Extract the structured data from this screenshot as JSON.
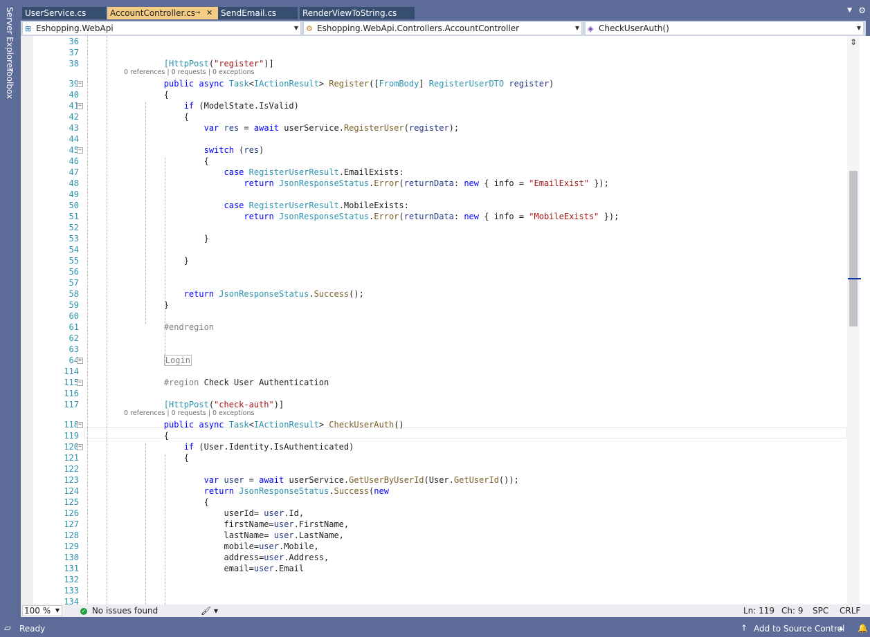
{
  "sidebar": {
    "server_explorer": "Server Explorer",
    "toolbox": "Toolbox"
  },
  "tabs": [
    {
      "label": "UserService.cs",
      "active": false
    },
    {
      "label": "AccountController.cs",
      "active": true
    },
    {
      "label": "SendEmail.cs",
      "active": false
    },
    {
      "label": "RenderViewToString.cs",
      "active": false
    }
  ],
  "tab_pin_glyph": "⊸",
  "tab_close_glyph": "✕",
  "navbar": {
    "project": "Eshopping.WebApi",
    "type": "Eshopping.WebApi.Controllers.AccountController",
    "member": "CheckUserAuth()"
  },
  "codelens": "0 references | 0 requests | 0 exceptions",
  "lines": [
    {
      "n": "36",
      "code": ""
    },
    {
      "n": "37",
      "code": ""
    },
    {
      "n": "38",
      "code": "        <span class=\"t\">[HttpPost</span>(<span class=\"s\">\"register\"</span>)]"
    },
    {
      "n": "39",
      "code": "        <span class=\"k\">public</span> <span class=\"k\">async</span> <span class=\"t\">Task</span>&lt;<span class=\"t\">IActionResult</span>&gt; <span class=\"m\">Register</span>([<span class=\"t\">FromBody</span>] <span class=\"t\">RegisterUserDTO</span> <span class=\"p\">register</span>)"
    },
    {
      "n": "40",
      "code": "        {"
    },
    {
      "n": "41",
      "code": "            <span class=\"k\">if</span> (ModelState.IsValid)"
    },
    {
      "n": "42",
      "code": "            {"
    },
    {
      "n": "43",
      "code": "                <span class=\"k\">var</span> <span class=\"p\">res</span> = <span class=\"k\">await</span> userService.<span class=\"m\">RegisterUser</span>(<span class=\"p\">register</span>);"
    },
    {
      "n": "44",
      "code": ""
    },
    {
      "n": "45",
      "code": "                <span class=\"k\">switch</span> (<span class=\"p\">res</span>)"
    },
    {
      "n": "46",
      "code": "                {"
    },
    {
      "n": "47",
      "code": "                    <span class=\"k\">case</span> <span class=\"t\">RegisterUserResult</span>.EmailExists:"
    },
    {
      "n": "48",
      "code": "                        <span class=\"k\">return</span> <span class=\"t\">JsonResponseStatus</span>.<span class=\"m\">Error</span>(<span class=\"p\">returnData</span>: <span class=\"k\">new</span> { info = <span class=\"s\">\"EmailExist\"</span> });"
    },
    {
      "n": "49",
      "code": ""
    },
    {
      "n": "50",
      "code": "                    <span class=\"k\">case</span> <span class=\"t\">RegisterUserResult</span>.MobileExists:"
    },
    {
      "n": "51",
      "code": "                        <span class=\"k\">return</span> <span class=\"t\">JsonResponseStatus</span>.<span class=\"m\">Error</span>(<span class=\"p\">returnData</span>: <span class=\"k\">new</span> { info = <span class=\"s\">\"MobileExists\"</span> });"
    },
    {
      "n": "52",
      "code": ""
    },
    {
      "n": "53",
      "code": "                }"
    },
    {
      "n": "54",
      "code": ""
    },
    {
      "n": "55",
      "code": "            }"
    },
    {
      "n": "56",
      "code": ""
    },
    {
      "n": "57",
      "code": ""
    },
    {
      "n": "58",
      "code": "            <span class=\"k\">return</span> <span class=\"t\">JsonResponseStatus</span>.<span class=\"m\">Success</span>();"
    },
    {
      "n": "59",
      "code": "        }"
    },
    {
      "n": "60",
      "code": ""
    },
    {
      "n": "61",
      "code": "        <span class=\"g\">#endregion</span>"
    },
    {
      "n": "62",
      "code": ""
    },
    {
      "n": "63",
      "code": ""
    },
    {
      "n": "64",
      "code": "        <span class=\"collapsed\">Login</span>"
    },
    {
      "n": "114",
      "code": ""
    },
    {
      "n": "115",
      "code": "        <span class=\"g\">#region</span> Check User Authentication"
    },
    {
      "n": "116",
      "code": ""
    },
    {
      "n": "117",
      "code": "        <span class=\"t\">[HttpPost</span>(<span class=\"s\">\"check-auth\"</span>)]"
    },
    {
      "n": "118",
      "code": "        <span class=\"k\">public</span> <span class=\"k\">async</span> <span class=\"t\">Task</span>&lt;<span class=\"t\">IActionResult</span>&gt; <span class=\"m\">CheckUserAuth</span>()"
    },
    {
      "n": "119",
      "code": "        {"
    },
    {
      "n": "120",
      "code": "            <span class=\"k\">if</span> (User.Identity.IsAuthenticated)"
    },
    {
      "n": "121",
      "code": "            {"
    },
    {
      "n": "122",
      "code": ""
    },
    {
      "n": "123",
      "code": "                <span class=\"k\">var</span> <span class=\"p\">user</span> = <span class=\"k\">await</span> userService.<span class=\"m\">GetUserByUserId</span>(User.<span class=\"m\">GetUserId</span>());"
    },
    {
      "n": "124",
      "code": "                <span class=\"k\">return</span> <span class=\"t\">JsonResponseStatus</span>.<span class=\"m\">Success</span>(<span class=\"k\">new</span>"
    },
    {
      "n": "125",
      "code": "                {"
    },
    {
      "n": "126",
      "code": "                    userId= <span class=\"p\">user</span>.Id,"
    },
    {
      "n": "127",
      "code": "                    firstName=<span class=\"p\">user</span>.FirstName,"
    },
    {
      "n": "128",
      "code": "                    lastName= <span class=\"p\">user</span>.LastName,"
    },
    {
      "n": "129",
      "code": "                    mobile=<span class=\"p\">user</span>.Mobile,"
    },
    {
      "n": "130",
      "code": "                    address=<span class=\"p\">user</span>.Address,"
    },
    {
      "n": "131",
      "code": "                    email=<span class=\"p\">user</span>.Email"
    },
    {
      "n": "132",
      "code": ""
    },
    {
      "n": "133",
      "code": ""
    },
    {
      "n": "134",
      "code": ""
    }
  ],
  "fold_markers": [
    {
      "line": "39",
      "glyph": "−"
    },
    {
      "line": "41",
      "glyph": "−"
    },
    {
      "line": "45",
      "glyph": "−"
    },
    {
      "line": "64",
      "glyph": "+"
    },
    {
      "line": "115",
      "glyph": "−"
    },
    {
      "line": "118",
      "glyph": "−"
    },
    {
      "line": "120",
      "glyph": "−"
    }
  ],
  "status": {
    "zoom": "100 %",
    "issues": "No issues found",
    "ln": "Ln: 119",
    "ch": "Ch: 9",
    "spc": "SPC",
    "crlf": "CRLF"
  },
  "bottom": {
    "ready": "Ready",
    "source_control": "Add to Source Control"
  },
  "colors": {
    "accent": "#5d6b99",
    "active_tab": "#f5cc84",
    "inactive_tab": "#364e6f"
  }
}
